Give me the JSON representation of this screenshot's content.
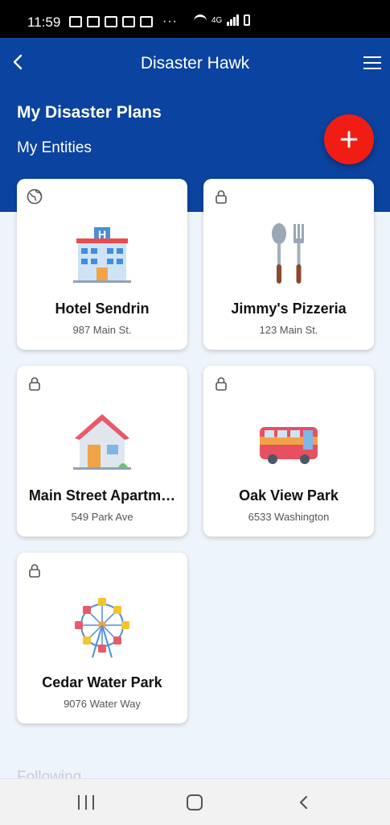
{
  "status_bar": {
    "time": "11:59",
    "network": "4G",
    "more_glyph": "···",
    "icons": [
      "message-icon",
      "message-icon",
      "message-icon",
      "image-icon",
      "camera-icon",
      "wifi-icon",
      "signal-icon",
      "battery-icon"
    ]
  },
  "header": {
    "app_title": "Disaster Hawk",
    "back_icon": "chevron-left-icon",
    "menu_icon": "hamburger-menu-icon",
    "page_title": "My Disaster Plans",
    "section_title": "My Entities",
    "fab_icon": "plus-icon",
    "colors": {
      "header_bg": "#0b43a0",
      "fab_bg": "#f11d14"
    }
  },
  "entities": [
    {
      "name": "Hotel Sendrin",
      "address": "987 Main St.",
      "corner_icon": "globe-icon",
      "illustration": "hotel-icon"
    },
    {
      "name": "Jimmy's Pizzeria",
      "address": "123 Main St.",
      "corner_icon": "lock-icon",
      "illustration": "spoon-fork-icon"
    },
    {
      "name": "Main Street Apartm…",
      "address": "549 Park Ave",
      "corner_icon": "lock-icon",
      "illustration": "house-icon"
    },
    {
      "name": "Oak View Park",
      "address": "6533 Washington",
      "corner_icon": "lock-icon",
      "illustration": "bus-icon"
    },
    {
      "name": "Cedar Water Park",
      "address": "9076 Water Way",
      "corner_icon": "lock-icon",
      "illustration": "ferris-wheel-icon"
    }
  ],
  "following_title": "Following",
  "nav_bar": {
    "icons": [
      "recents-icon",
      "home-icon",
      "back-icon"
    ]
  }
}
